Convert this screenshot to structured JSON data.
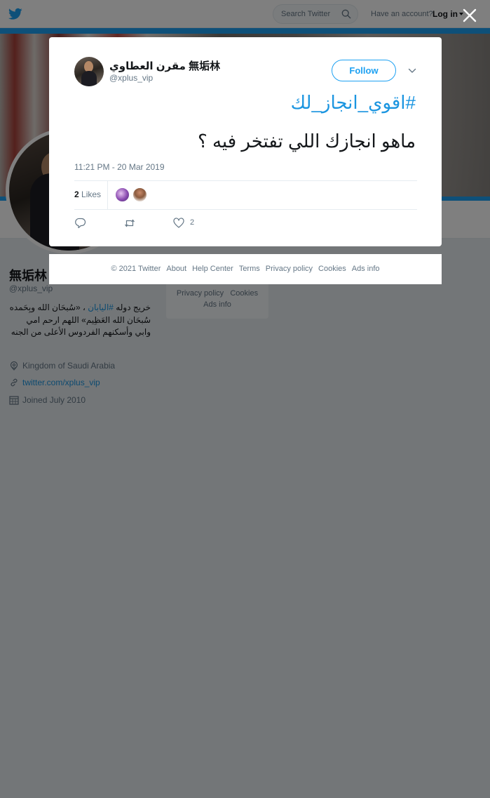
{
  "topbar": {
    "search_placeholder": "Search Twitter",
    "account_question": "Have an account?",
    "login_label": "Log in"
  },
  "profile": {
    "name": "無垢林",
    "handle": "@xplus_vip",
    "bio_part1": "خريج دوله ",
    "bio_hashtag": "#اليابان",
    "bio_part2": " ، «سُبحَان الله وبِحَمده سُبحَان الله العَظِيم» اللهم ارحم امي وابي وأسكنهم الفردوس الأعلى من الجنه",
    "location": "Kingdom of Saudi Arabia",
    "website": "twitter.com/xplus_vip",
    "joined": "Joined July 2010"
  },
  "side_card": {
    "line1": "Privacy policy",
    "line1b": "Cookies",
    "line2": "Ads info"
  },
  "tweet": {
    "author_name": "مقرن العطاوي 無垢林",
    "author_handle": "@xplus_vip",
    "follow_label": "Follow",
    "hashtag": "#اقوي_انجاز_لك",
    "text": "ماهو انجازك اللي تفتخر فيه ؟",
    "timestamp": "11:21 PM - 20 Mar 2019",
    "likes_number": "2",
    "likes_word": "Likes",
    "like_action_count": "2"
  },
  "footer": {
    "links": [
      "© 2021 Twitter",
      "About",
      "Help Center",
      "Terms",
      "Privacy policy",
      "Cookies",
      "Ads info"
    ]
  },
  "colors": {
    "brand": "#1da1f2",
    "link": "#1b95e0",
    "secondary_text": "#657786",
    "overlay": "rgba(0,0,0,0.5)"
  }
}
